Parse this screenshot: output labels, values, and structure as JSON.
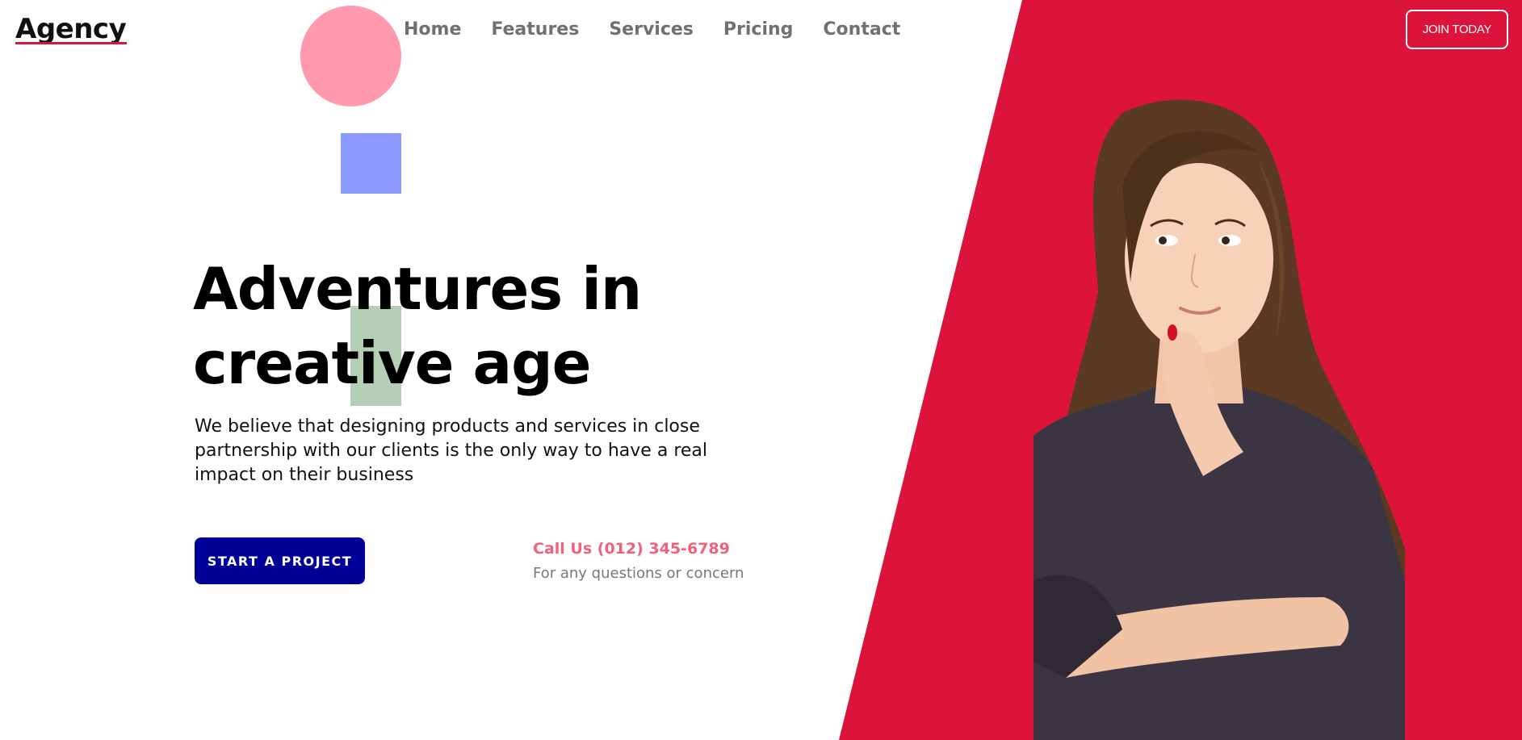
{
  "brand": {
    "logo_text": "Agency",
    "accent": "#dc143c"
  },
  "nav": {
    "items": [
      {
        "label": "Home"
      },
      {
        "label": "Features"
      },
      {
        "label": "Services"
      },
      {
        "label": "Pricing"
      },
      {
        "label": "Contact"
      }
    ],
    "join_label": "JOIN TODAY"
  },
  "hero": {
    "headline_line1": "Adventures in",
    "headline_line2": "creative age",
    "description": "We believe that designing products and services in close partnership with our clients is the only way to have a real impact on their business",
    "cta_label": "START A PROJECT",
    "call_label": "Call Us (012) 345-6789",
    "call_sub": "For any questions or concern"
  },
  "colors": {
    "panel": "#dc143c",
    "cta": "#000099",
    "circle": "#ff99ad",
    "square": "#8b9aff",
    "rect": "#b5cfb6",
    "call": "#f0617b"
  }
}
